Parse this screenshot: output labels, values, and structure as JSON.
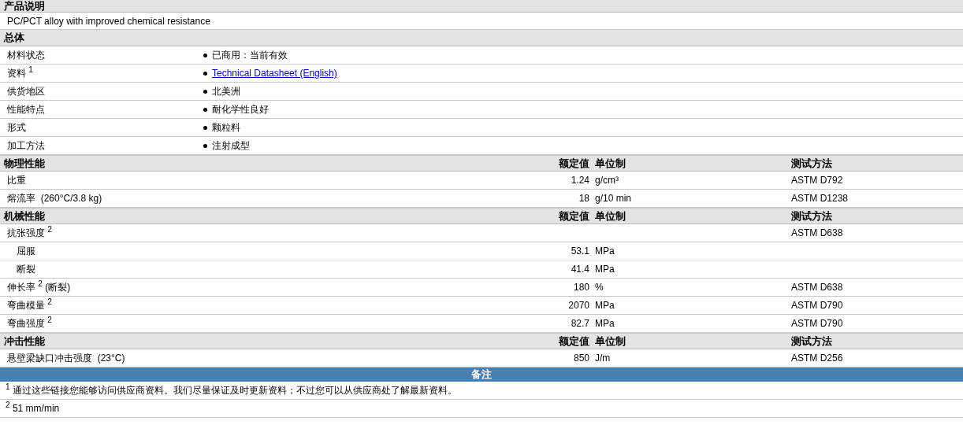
{
  "description": {
    "title": "产品说明",
    "text": "PC/PCT alloy with improved chemical resistance"
  },
  "general": {
    "title": "总体",
    "rows": [
      {
        "label": "材料状态",
        "value": "已商用：当前有效",
        "kind": "text"
      },
      {
        "label": "资料 $^{1}$",
        "value": "Technical Datasheet (English)",
        "kind": "link"
      },
      {
        "label": "供货地区",
        "value": "北美洲",
        "kind": "text"
      },
      {
        "label": "性能特点",
        "value": "耐化学性良好",
        "kind": "text"
      },
      {
        "label": "形式",
        "value": "颗粒料",
        "kind": "text"
      },
      {
        "label": "加工方法",
        "value": "注射成型",
        "kind": "text"
      }
    ]
  },
  "sections": [
    {
      "title": "物理性能",
      "columns": [
        "额定值",
        "单位制",
        "测试方法"
      ],
      "rows": [
        {
          "property": "比重",
          "value": "1.24",
          "unit": "g/cm³",
          "method": "ASTM D792"
        },
        {
          "property": "熔流率  (260°C/3.8 kg)",
          "value": "18",
          "unit": "g/10 min",
          "method": "ASTM D1238"
        }
      ]
    },
    {
      "title": "机械性能",
      "columns": [
        "额定值",
        "单位制",
        "测试方法"
      ],
      "rows": [
        {
          "property": "抗张强度 $^{2}$",
          "method": "ASTM D638",
          "children": [
            {
              "property": "屈服",
              "value": "53.1",
              "unit": "MPa"
            },
            {
              "property": "断裂",
              "value": "41.4",
              "unit": "MPa"
            }
          ]
        },
        {
          "property": "伸长率 $^{2}$ (断裂)",
          "value": "180",
          "unit": "%",
          "method": "ASTM D638"
        },
        {
          "property": "弯曲模量 $^{2}$",
          "value": "2070",
          "unit": "MPa",
          "method": "ASTM D790"
        },
        {
          "property": "弯曲强度 $^{2}$",
          "value": "82.7",
          "unit": "MPa",
          "method": "ASTM D790"
        }
      ]
    },
    {
      "title": "冲击性能",
      "columns": [
        "额定值",
        "单位制",
        "测试方法"
      ],
      "rows": [
        {
          "property": "悬壁梁缺口冲击强度  (23°C)",
          "value": "850",
          "unit": "J/m",
          "method": "ASTM D256"
        }
      ]
    }
  ],
  "notes": {
    "title": "备注",
    "items": [
      "$^{1}$ 通过这些链接您能够访问供应商资料。我们尽量保证及时更新资料；不过您可以从供应商处了解最新资料。",
      "$^{2}$ 51 mm/min"
    ]
  }
}
